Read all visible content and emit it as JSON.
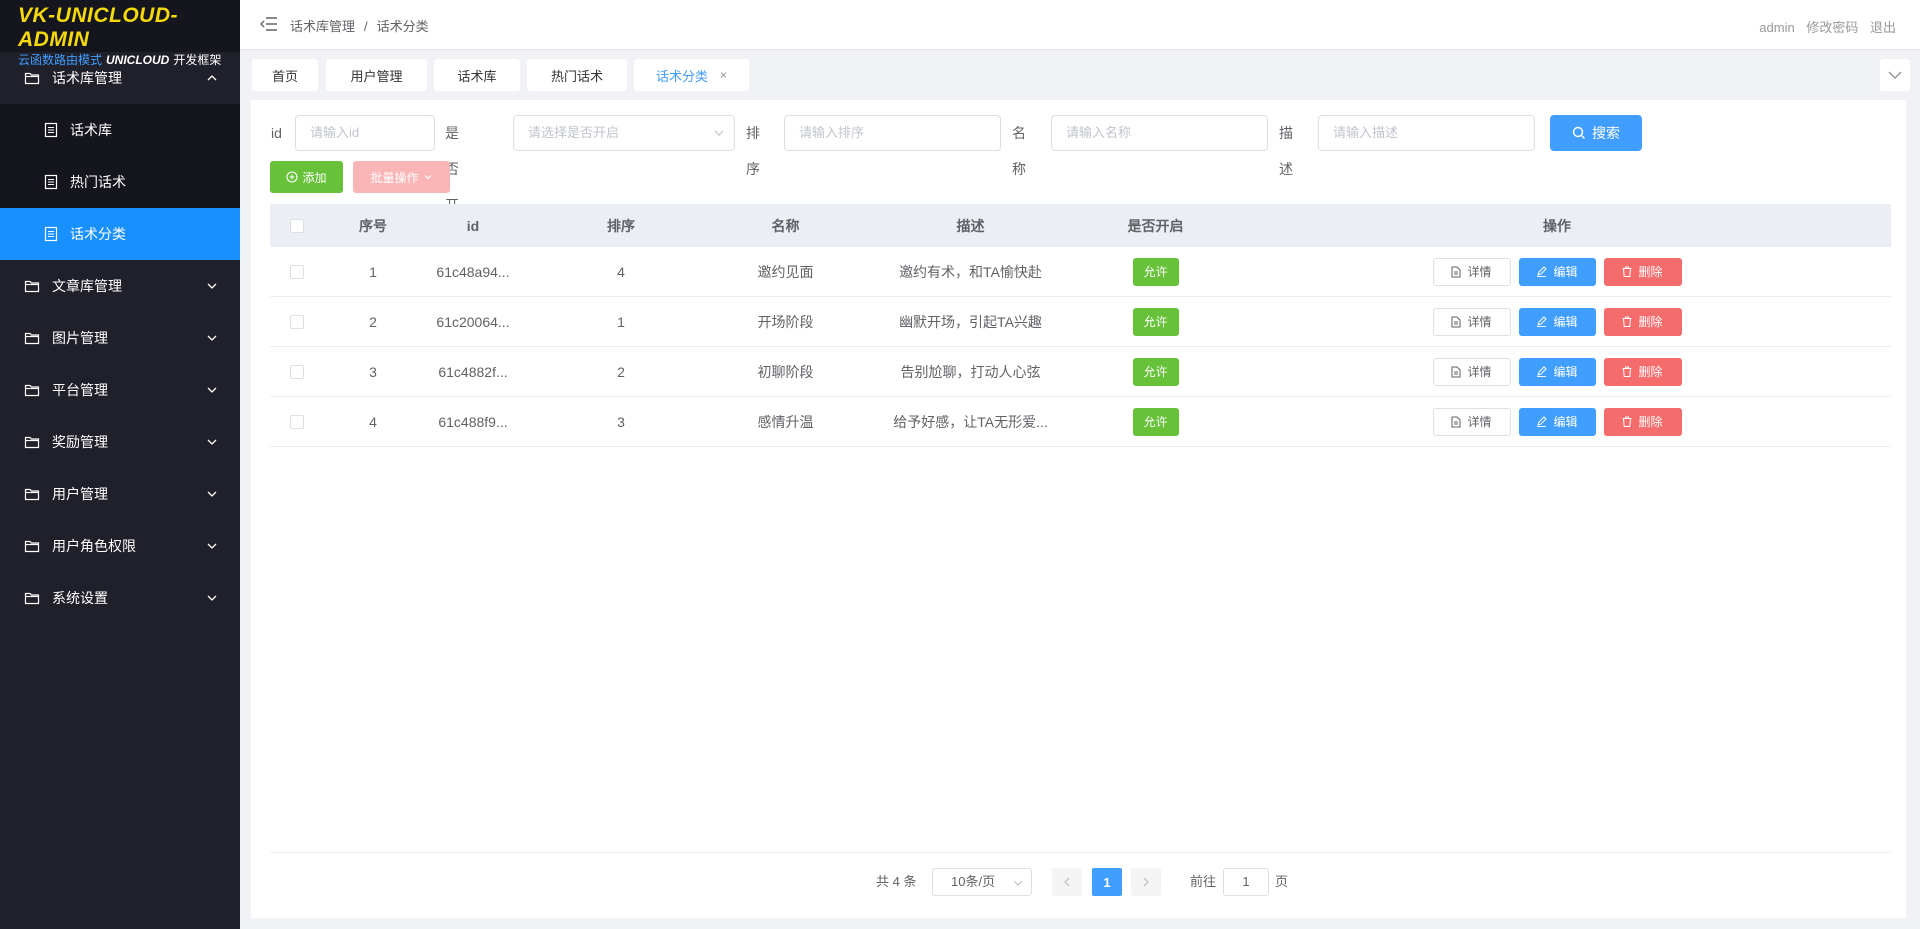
{
  "logo": {
    "title": "VK-UNICLOUD-ADMIN",
    "sub_prefix": "云函数路由模式",
    "sub_brand": "UNICLOUD",
    "sub_suffix": "开发框架"
  },
  "sidebar": {
    "open_group": "话术库管理",
    "sub_items": [
      "话术库",
      "热门话术",
      "话术分类"
    ],
    "groups": [
      "文章库管理",
      "图片管理",
      "平台管理",
      "奖励管理",
      "用户管理",
      "用户角色权限",
      "系统设置"
    ]
  },
  "header": {
    "breadcrumb": [
      "话术库管理",
      "话术分类"
    ],
    "breadcrumb_sep": "/",
    "user": "admin",
    "change_password": "修改密码",
    "logout": "退出"
  },
  "tabs": [
    "首页",
    "用户管理",
    "话术库",
    "热门话术",
    "话术分类"
  ],
  "tab_close": "×",
  "search": {
    "id_label": "id",
    "id_placeholder": "请输入id",
    "open_label": "是否开启",
    "open_placeholder": "请选择是否开启",
    "sort_label": "排序",
    "sort_placeholder": "请输入排序",
    "name_label": "名称",
    "name_placeholder": "请输入名称",
    "desc_label": "描述",
    "desc_placeholder": "请输入描述",
    "search_button": "搜索"
  },
  "toolbar": {
    "add": "添加",
    "batch": "批量操作"
  },
  "table": {
    "headers": [
      "序号",
      "id",
      "排序",
      "名称",
      "描述",
      "是否开启",
      "操作"
    ],
    "rows": [
      {
        "seq": "1",
        "id": "61c48a94...",
        "sort": "4",
        "name": "邀约见面",
        "desc": "邀约有术，和TA愉快赴",
        "open": "允许"
      },
      {
        "seq": "2",
        "id": "61c20064...",
        "sort": "1",
        "name": "开场阶段",
        "desc": "幽默开场，引起TA兴趣",
        "open": "允许"
      },
      {
        "seq": "3",
        "id": "61c4882f...",
        "sort": "2",
        "name": "初聊阶段",
        "desc": "告别尬聊，打动人心弦",
        "open": "允许"
      },
      {
        "seq": "4",
        "id": "61c488f9...",
        "sort": "3",
        "name": "感情升温",
        "desc": "给予好感，让TA无形爱...",
        "open": "允许"
      }
    ],
    "ops": {
      "detail": "详情",
      "edit": "编辑",
      "delete": "删除"
    }
  },
  "pagination": {
    "total": "共 4 条",
    "page_size": "10条/页",
    "current": "1",
    "goto_prefix": "前往",
    "goto_value": "1",
    "goto_suffix": "页"
  },
  "colors": {
    "sidebar_bg": "#1f2029",
    "active": "#1890ff",
    "primary": "#409eff",
    "success": "#67c23a",
    "danger": "#f56c6c",
    "logo": "#f5d90a"
  }
}
